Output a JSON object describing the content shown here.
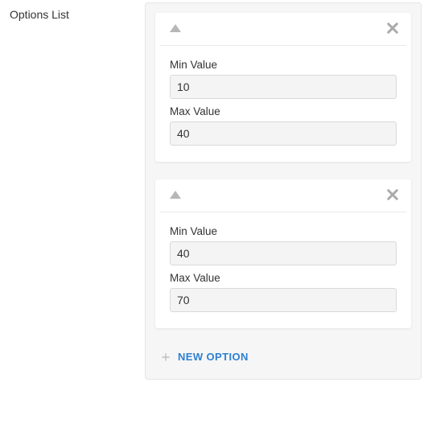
{
  "page_title": "Options List",
  "labels": {
    "min": "Min Value",
    "max": "Max Value",
    "new_option": "NEW OPTION"
  },
  "options": [
    {
      "min": "10",
      "max": "40"
    },
    {
      "min": "40",
      "max": "70"
    }
  ]
}
